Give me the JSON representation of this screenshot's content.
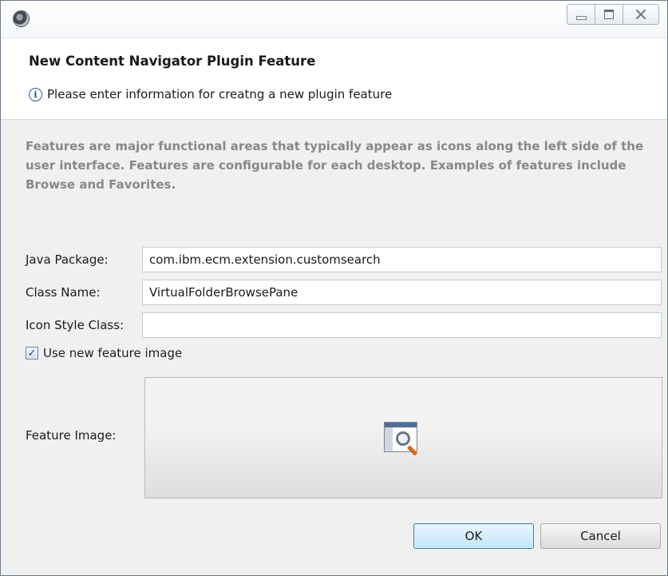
{
  "window": {
    "app_icon": "eclipse-icon",
    "controls": [
      "minimize-icon",
      "maximize-icon",
      "close-icon"
    ]
  },
  "dialog": {
    "title": "New Content Navigator Plugin Feature",
    "info_icon": "info-icon",
    "info_text": "Please enter information for creatng a new plugin feature",
    "description": "Features are major functional areas that typically appear as icons along the left side of the user interface. Features are configurable for each desktop. Examples of features include Browse and Favorites."
  },
  "form": {
    "java_package": {
      "label": "Java Package:",
      "value": "com.ibm.ecm.extension.customsearch"
    },
    "class_name": {
      "label": "Class Name:",
      "value": "VirtualFolderBrowsePane"
    },
    "icon_style_class": {
      "label": "Icon Style Class:",
      "value": ""
    },
    "use_new_feature_image": {
      "label": "Use new feature image",
      "checked": true
    },
    "feature_image": {
      "label": "Feature Image:",
      "icon": "search-window-icon"
    }
  },
  "buttons": {
    "ok": "OK",
    "cancel": "Cancel"
  }
}
